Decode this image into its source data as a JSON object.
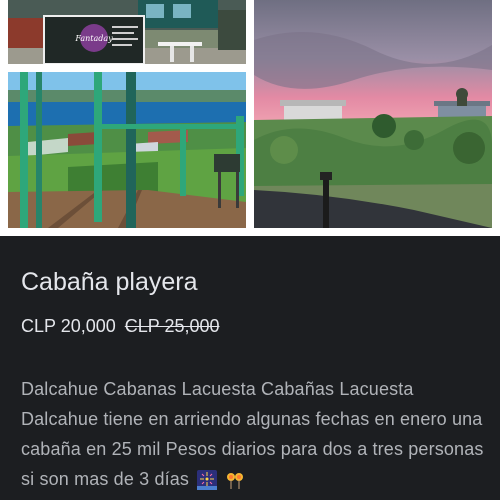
{
  "photos": {
    "sign_text": "Fantaday",
    "count": 3
  },
  "listing": {
    "title": "Cabaña playera",
    "price_current": "CLP 20,000",
    "price_original": "CLP 25,000",
    "description": "Dalcahue Cabanas Lacuesta Cabañas Lacuesta Dalcahue  tiene en arriendo algunas fechas en enero una cabaña en 25 mil Pesos diarios para dos a tres personas si son mas de 3 días",
    "emojis": [
      "fireworks-icon",
      "sparkler-icon"
    ]
  },
  "colors": {
    "panel_bg": "#1c1e21",
    "title": "#e4e6eb",
    "body_text": "#b0b3b8"
  }
}
